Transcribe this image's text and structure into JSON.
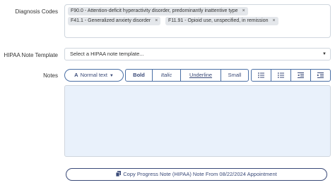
{
  "diagnosis": {
    "label": "Diagnosis Codes",
    "codes": [
      {
        "text": "F90.0 - Attention-deficit hyperactivity disorder, predominantly inattentive type",
        "remove": "×"
      },
      {
        "text": "F41.1 - Generalized anxiety disorder",
        "remove": "×"
      },
      {
        "text": "F11.91 - Opioid use, unspecified, in remission",
        "remove": "×"
      }
    ]
  },
  "template": {
    "label": "HIPAA Note Template",
    "placeholder": "Select a HIPAA note template..."
  },
  "notes": {
    "label": "Notes",
    "format_dropdown": "Normal text",
    "format_icon": "A",
    "styles": {
      "bold": "Bold",
      "italic": "Italic",
      "underline": "Underline",
      "small": "Small"
    },
    "list_icons": [
      "bullet-list-icon",
      "numbered-list-icon",
      "outdent-icon",
      "indent-icon"
    ]
  },
  "copy_button": {
    "label": "Copy Progress Note (HIPAA) Note From 08/22/2024 Appointment",
    "icon": "copy-icon"
  },
  "colors": {
    "accent": "#3a4a78",
    "editor_bg": "#e9f1fb",
    "chip_bg": "#e4e7eb"
  }
}
